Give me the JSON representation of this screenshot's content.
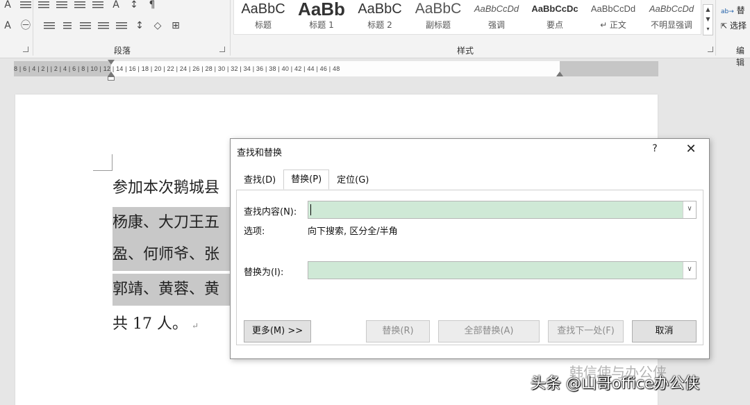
{
  "ribbon": {
    "paragraph_group_label": "段落",
    "styles_group_label": "样式",
    "editing_group_label": "编辑",
    "editing_items": [
      {
        "label": "替",
        "icon": "replace-icon"
      },
      {
        "label": "选择",
        "icon": "select-cursor-icon"
      }
    ],
    "styles": [
      {
        "sample": "AaBbC",
        "name": "标题",
        "variant": "heading"
      },
      {
        "sample": "AaBb",
        "name": "标题 1",
        "variant": "heading1"
      },
      {
        "sample": "AaBbC",
        "name": "标题 2",
        "variant": "heading2"
      },
      {
        "sample": "AaBbC",
        "name": "副标题",
        "variant": "subtitle"
      },
      {
        "sample": "AaBbCcDd",
        "name": "强调",
        "variant": "emphasis"
      },
      {
        "sample": "AaBbCcDc",
        "name": "要点",
        "variant": "strong"
      },
      {
        "sample": "AaBbCcDd",
        "name": "↵ 正文",
        "variant": "normal"
      },
      {
        "sample": "AaBbCcDd",
        "name": "不明显强调",
        "variant": "subtle"
      }
    ]
  },
  "ruler": {
    "labels": "8 | 6 | 4 | 2 |   | 2 | 4 | 6 | 8 | 10 | 12 | 14 | 16 | 18 | 20 | 22 | 24 | 26 | 28 | 30 | 32 | 34 | 36 | 38 | 40 | 42 | 44 | 46 | 48"
  },
  "document": {
    "lines": [
      "参加本次鹅城县",
      "杨康、大刀王五",
      "盈、何师爷、张",
      "郭靖、黄蓉、黄",
      "共 17 人。"
    ],
    "paragraph_mark": "↵"
  },
  "dialog": {
    "title": "查找和替换",
    "help": "?",
    "close": "✕",
    "tabs": [
      "查找(D)",
      "替换(P)",
      "定位(G)"
    ],
    "active_tab": "替换(P)",
    "find_label": "查找内容(N):",
    "find_value": "",
    "options_label": "选项:",
    "options_value": "向下搜索, 区分全/半角",
    "replace_label": "替换为(I):",
    "replace_value": "",
    "input_bg_color": "#cfe9d6",
    "buttons": {
      "more": "更多(M) >>",
      "replace": "替换(R)",
      "replace_all": "全部替换(A)",
      "find_next": "查找下一处(F)",
      "cancel": "取消"
    }
  },
  "watermark": {
    "faint": "韩信使与办公侠",
    "main": "头条 @山哥office办公侠"
  }
}
